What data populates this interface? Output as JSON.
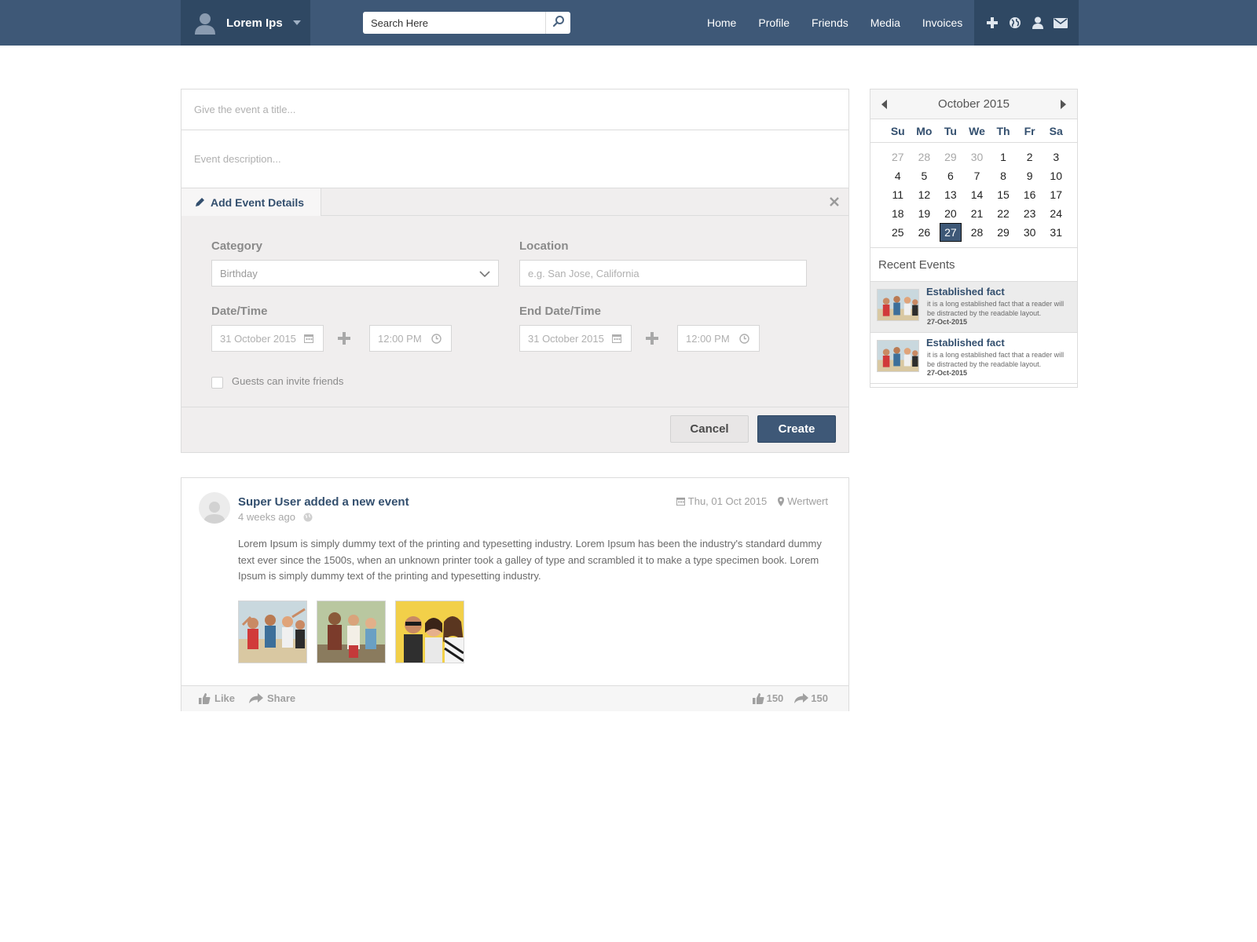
{
  "header": {
    "user_name": "Lorem Ips",
    "search_placeholder": "Search Here",
    "nav": [
      "Home",
      "Profile",
      "Friends",
      "Media",
      "Invoices"
    ],
    "nav_icons": [
      "plus-icon",
      "globe-icon",
      "user-icon",
      "mail-icon"
    ]
  },
  "event_form": {
    "title_placeholder": "Give the event a title...",
    "description_placeholder": "Event description...",
    "details_tab": "Add Event Details",
    "category_label": "Category",
    "category_value": "Birthday",
    "location_label": "Location",
    "location_placeholder": "e.g. San Jose, California",
    "datetime_label": "Date/Time",
    "start_date": "31 October 2015",
    "start_time": "12:00 PM",
    "end_datetime_label": "End Date/Time",
    "end_date": "31 October 2015",
    "end_time": "12:00 PM",
    "guests_label": "Guests can invite friends",
    "cancel": "Cancel",
    "create": "Create"
  },
  "post": {
    "title": "Super User added a new event",
    "time": "4 weeks ago",
    "date": "Thu, 01 Oct 2015",
    "location": "Wertwert",
    "text": "Lorem Ipsum is simply dummy text of the printing and typesetting industry. Lorem Ipsum has been the industry's standard dummy text ever since the 1500s, when an unknown printer took a galley of type and scrambled it to make a type specimen book. Lorem Ipsum is simply dummy text of the printing and typesetting industry.",
    "like": "Like",
    "share": "Share",
    "like_count": "150",
    "share_count": "150"
  },
  "calendar": {
    "month": "October 2015",
    "weekdays": [
      "Su",
      "Mo",
      "Tu",
      "We",
      "Th",
      "Fr",
      "Sa"
    ],
    "days": [
      {
        "d": "27",
        "muted": true
      },
      {
        "d": "28",
        "muted": true
      },
      {
        "d": "29",
        "muted": true
      },
      {
        "d": "30",
        "muted": true
      },
      {
        "d": "1"
      },
      {
        "d": "2"
      },
      {
        "d": "3"
      },
      {
        "d": "4"
      },
      {
        "d": "5"
      },
      {
        "d": "6"
      },
      {
        "d": "7"
      },
      {
        "d": "8"
      },
      {
        "d": "9"
      },
      {
        "d": "10"
      },
      {
        "d": "11"
      },
      {
        "d": "12"
      },
      {
        "d": "13"
      },
      {
        "d": "14"
      },
      {
        "d": "15"
      },
      {
        "d": "16"
      },
      {
        "d": "17"
      },
      {
        "d": "18"
      },
      {
        "d": "19"
      },
      {
        "d": "20"
      },
      {
        "d": "21"
      },
      {
        "d": "22"
      },
      {
        "d": "23"
      },
      {
        "d": "24"
      },
      {
        "d": "25"
      },
      {
        "d": "26"
      },
      {
        "d": "27",
        "today": true
      },
      {
        "d": "28"
      },
      {
        "d": "29"
      },
      {
        "d": "30"
      },
      {
        "d": "31"
      }
    ]
  },
  "recent_events": {
    "title": "Recent Events",
    "items": [
      {
        "title": "Established fact",
        "text": "it is a long established fact that a reader will be distracted by the readable layout.",
        "date": "27-Oct-2015"
      },
      {
        "title": "Established fact",
        "text": "it is a long established fact that a reader will be distracted by the readable layout.",
        "date": "27-Oct-2015"
      }
    ]
  },
  "colors": {
    "topbar": "#3e5877",
    "topbar_dark": "#2f4863",
    "accent_text": "#334f6e",
    "panel_bg": "#f0eeee"
  }
}
